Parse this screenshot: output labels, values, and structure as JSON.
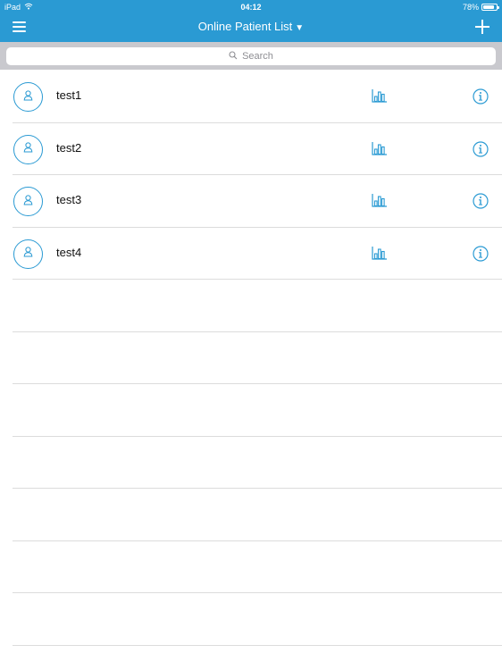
{
  "status": {
    "device": "iPad",
    "time": "04:12",
    "battery": "78%",
    "battery_level": 0.78
  },
  "header": {
    "title": "Online Patient List",
    "caret": "▼"
  },
  "search": {
    "placeholder": "Search"
  },
  "patients": [
    {
      "name": "test1"
    },
    {
      "name": "test2"
    },
    {
      "name": "test3"
    },
    {
      "name": "test4"
    }
  ],
  "empty_rows": 7,
  "colors": {
    "accent": "#2a9ad3",
    "separator": "#dcdcdc",
    "search_bar_bg": "#c9c9ce"
  },
  "icons": [
    "wifi-icon",
    "battery-icon",
    "menu-icon",
    "add-icon",
    "search-icon",
    "person-icon",
    "bar-chart-icon",
    "info-icon"
  ]
}
